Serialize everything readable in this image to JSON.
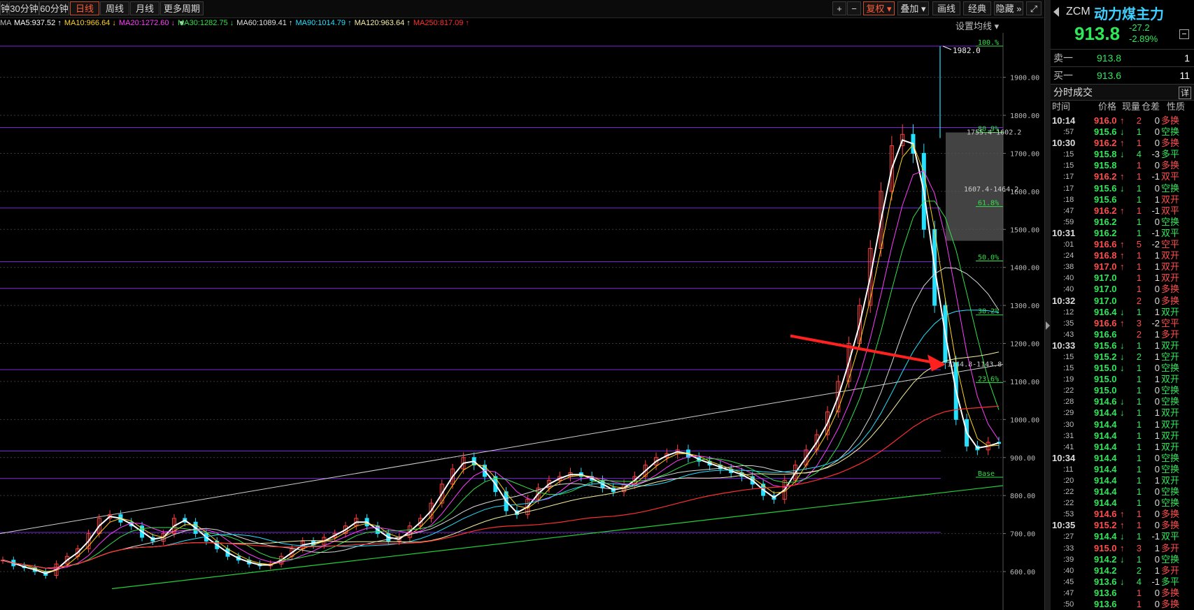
{
  "toolbar": {
    "periods": [
      {
        "label": "钟",
        "active": false
      },
      {
        "label": "30分钟",
        "active": false
      },
      {
        "label": "60分钟",
        "active": false
      },
      {
        "label": "日线",
        "active": true
      },
      {
        "label": "周线",
        "active": false
      },
      {
        "label": "月线",
        "active": false
      },
      {
        "label": "更多周期",
        "active": false
      }
    ],
    "right": {
      "plus": "+",
      "minus": "−",
      "fuquan": "复权",
      "overlay": "叠加",
      "draw": "画线",
      "classic": "经典",
      "hide": "隐藏"
    }
  },
  "ma_bar": {
    "prefix": "MA",
    "items": [
      {
        "label": "MA5:937.52",
        "arrow": "↑",
        "color": "#ffffff"
      },
      {
        "label": "MA10:966.64",
        "arrow": "↓",
        "color": "#ffd21a"
      },
      {
        "label": "MA20:1272.60",
        "arrow": "↓",
        "color": "#ff3cff"
      },
      {
        "label": "MA30:1282.75",
        "arrow": "↓",
        "color": "#33e04a"
      },
      {
        "label": "MA60:1089.41",
        "arrow": "↑",
        "color": "#e0e0e0"
      },
      {
        "label": "MA90:1014.79",
        "arrow": "↑",
        "color": "#25e0ff"
      },
      {
        "label": "MA120:963.64",
        "arrow": "↑",
        "color": "#f5f0a0"
      },
      {
        "label": "MA250:817.09",
        "arrow": "↑",
        "color": "#ff3030"
      }
    ],
    "settings": "设置均线"
  },
  "chart_data": {
    "type": "candlestick",
    "y_ticks": [
      "1900.00",
      "1800.00",
      "1700.00",
      "1600.00",
      "1500.00",
      "1400.00",
      "1300.00",
      "1200.00",
      "1100.00",
      "1000.00",
      "900.00",
      "800.00",
      "700.00",
      "600.00"
    ],
    "ylim": [
      562,
      1982
    ],
    "peak_label": "1982.0",
    "fib_labels": [
      {
        "text": "100.%",
        "value": 1982
      },
      {
        "text": "80.9%",
        "value": 1755
      },
      {
        "text": "61.8%",
        "value": 1560
      },
      {
        "text": "50.0%",
        "value": 1417
      },
      {
        "text": "38.2%",
        "value": 1275
      },
      {
        "text": "23.6%",
        "value": 1097
      },
      {
        "text": "Base",
        "value": 848
      }
    ],
    "fib_lines": [
      1982,
      1768,
      1556,
      1415,
      1345,
      1131,
      917,
      845,
      703
    ],
    "box_labels": [
      "1755.4-1602.2",
      "1607.4-1464.2",
      "1144.8-1143.8"
    ],
    "ohlc_close_path": [
      630,
      615,
      610,
      600,
      590,
      620,
      640,
      660,
      700,
      740,
      750,
      730,
      720,
      690,
      680,
      700,
      740,
      730,
      700,
      680,
      660,
      640,
      630,
      620,
      615,
      620,
      640,
      660,
      680,
      670,
      690,
      700,
      720,
      740,
      720,
      700,
      680,
      690,
      720,
      740,
      780,
      830,
      870,
      900,
      880,
      850,
      810,
      760,
      750,
      790,
      820,
      840,
      850,
      860,
      850,
      840,
      820,
      810,
      830,
      850,
      880,
      900,
      910,
      920,
      900,
      890,
      880,
      870,
      860,
      850,
      830,
      800,
      790,
      840,
      880,
      920,
      960,
      1020,
      1100,
      1200,
      1300,
      1450,
      1600,
      1720,
      1750,
      1700,
      1500,
      1300,
      1150,
      1000,
      930,
      920,
      940,
      937
    ],
    "x_days": 94
  },
  "right_panel": {
    "code": "ZCM",
    "name": "动力煤主力",
    "price": "913.8",
    "change": "-27.2",
    "change_pct": "-2.89%",
    "sell1": {
      "label": "卖一",
      "price": "913.8",
      "qty": "1"
    },
    "buy1": {
      "label": "买一",
      "price": "913.6",
      "qty": "11"
    },
    "section_title": "分时成交",
    "detail": "详",
    "headers": {
      "time": "时间",
      "price": "价格",
      "vol": "现量",
      "oi": "仓差",
      "nature": "性质"
    },
    "ticks": [
      {
        "t": "10:14",
        "big": true,
        "p": "916.0",
        "d": "↑",
        "v": "2",
        "oi": "0",
        "n": "多换",
        "pc": "red",
        "vc": "red",
        "nc": "red"
      },
      {
        "t": ":57",
        "big": false,
        "p": "915.6",
        "d": "↓",
        "v": "1",
        "oi": "0",
        "n": "空换",
        "pc": "green",
        "vc": "green",
        "nc": "green"
      },
      {
        "t": "10:30",
        "big": true,
        "p": "916.2",
        "d": "↑",
        "v": "1",
        "oi": "0",
        "n": "多换",
        "pc": "red",
        "vc": "red",
        "nc": "red"
      },
      {
        "t": ":15",
        "big": false,
        "p": "915.8",
        "d": "↓",
        "v": "4",
        "oi": "-3",
        "n": "多平",
        "pc": "green",
        "vc": "green",
        "nc": "green"
      },
      {
        "t": ":15",
        "big": false,
        "p": "915.8",
        "d": "",
        "v": "1",
        "oi": "0",
        "n": "多换",
        "pc": "green",
        "vc": "red",
        "nc": "red"
      },
      {
        "t": ":17",
        "big": false,
        "p": "916.2",
        "d": "↑",
        "v": "1",
        "oi": "-1",
        "n": "双平",
        "pc": "red",
        "vc": "red",
        "nc": "red"
      },
      {
        "t": ":17",
        "big": false,
        "p": "915.6",
        "d": "↓",
        "v": "1",
        "oi": "0",
        "n": "空换",
        "pc": "green",
        "vc": "green",
        "nc": "green"
      },
      {
        "t": ":18",
        "big": false,
        "p": "915.6",
        "d": "",
        "v": "1",
        "oi": "1",
        "n": "双开",
        "pc": "green",
        "vc": "green",
        "nc": "red"
      },
      {
        "t": ":47",
        "big": false,
        "p": "916.2",
        "d": "↑",
        "v": "1",
        "oi": "-1",
        "n": "双平",
        "pc": "red",
        "vc": "red",
        "nc": "red"
      },
      {
        "t": ":59",
        "big": false,
        "p": "916.2",
        "d": "",
        "v": "1",
        "oi": "0",
        "n": "空换",
        "pc": "green",
        "vc": "green",
        "nc": "green"
      },
      {
        "t": "10:31",
        "big": true,
        "p": "916.2",
        "d": "",
        "v": "1",
        "oi": "-1",
        "n": "双平",
        "pc": "green",
        "vc": "green",
        "nc": "green"
      },
      {
        "t": ":01",
        "big": false,
        "p": "916.6",
        "d": "↑",
        "v": "5",
        "oi": "-2",
        "n": "空平",
        "pc": "red",
        "vc": "red",
        "nc": "red"
      },
      {
        "t": ":24",
        "big": false,
        "p": "916.8",
        "d": "↑",
        "v": "1",
        "oi": "1",
        "n": "双开",
        "pc": "red",
        "vc": "red",
        "nc": "red"
      },
      {
        "t": ":38",
        "big": false,
        "p": "917.0",
        "d": "↑",
        "v": "1",
        "oi": "1",
        "n": "双开",
        "pc": "red",
        "vc": "red",
        "nc": "red"
      },
      {
        "t": ":40",
        "big": false,
        "p": "917.0",
        "d": "",
        "v": "1",
        "oi": "1",
        "n": "双开",
        "pc": "green",
        "vc": "red",
        "nc": "red"
      },
      {
        "t": ":40",
        "big": false,
        "p": "917.0",
        "d": "",
        "v": "1",
        "oi": "0",
        "n": "多换",
        "pc": "green",
        "vc": "red",
        "nc": "red"
      },
      {
        "t": "10:32",
        "big": true,
        "p": "917.0",
        "d": "",
        "v": "2",
        "oi": "0",
        "n": "多换",
        "pc": "green",
        "vc": "red",
        "nc": "red"
      },
      {
        "t": ":12",
        "big": false,
        "p": "916.4",
        "d": "↓",
        "v": "1",
        "oi": "1",
        "n": "双开",
        "pc": "green",
        "vc": "green",
        "nc": "green"
      },
      {
        "t": ":35",
        "big": false,
        "p": "916.6",
        "d": "↑",
        "v": "3",
        "oi": "-2",
        "n": "空平",
        "pc": "red",
        "vc": "red",
        "nc": "red"
      },
      {
        "t": ":43",
        "big": false,
        "p": "916.6",
        "d": "",
        "v": "2",
        "oi": "1",
        "n": "多开",
        "pc": "green",
        "vc": "red",
        "nc": "red"
      },
      {
        "t": "10:33",
        "big": true,
        "p": "915.6",
        "d": "↓",
        "v": "1",
        "oi": "1",
        "n": "双开",
        "pc": "green",
        "vc": "green",
        "nc": "green"
      },
      {
        "t": ":15",
        "big": false,
        "p": "915.2",
        "d": "↓",
        "v": "2",
        "oi": "1",
        "n": "空开",
        "pc": "green",
        "vc": "green",
        "nc": "green"
      },
      {
        "t": ":15",
        "big": false,
        "p": "915.0",
        "d": "↓",
        "v": "1",
        "oi": "0",
        "n": "空换",
        "pc": "green",
        "vc": "green",
        "nc": "green"
      },
      {
        "t": ":19",
        "big": false,
        "p": "915.0",
        "d": "",
        "v": "1",
        "oi": "1",
        "n": "双开",
        "pc": "green",
        "vc": "green",
        "nc": "green"
      },
      {
        "t": ":22",
        "big": false,
        "p": "915.0",
        "d": "",
        "v": "1",
        "oi": "0",
        "n": "空换",
        "pc": "green",
        "vc": "green",
        "nc": "green"
      },
      {
        "t": ":28",
        "big": false,
        "p": "914.6",
        "d": "↓",
        "v": "1",
        "oi": "0",
        "n": "空换",
        "pc": "green",
        "vc": "green",
        "nc": "green"
      },
      {
        "t": ":29",
        "big": false,
        "p": "914.4",
        "d": "↓",
        "v": "1",
        "oi": "1",
        "n": "双开",
        "pc": "green",
        "vc": "green",
        "nc": "green"
      },
      {
        "t": ":30",
        "big": false,
        "p": "914.4",
        "d": "",
        "v": "1",
        "oi": "1",
        "n": "双开",
        "pc": "green",
        "vc": "green",
        "nc": "green"
      },
      {
        "t": ":31",
        "big": false,
        "p": "914.4",
        "d": "",
        "v": "1",
        "oi": "1",
        "n": "双开",
        "pc": "green",
        "vc": "green",
        "nc": "green"
      },
      {
        "t": ":41",
        "big": false,
        "p": "914.4",
        "d": "",
        "v": "1",
        "oi": "1",
        "n": "双开",
        "pc": "green",
        "vc": "green",
        "nc": "green"
      },
      {
        "t": "10:34",
        "big": true,
        "p": "914.4",
        "d": "",
        "v": "1",
        "oi": "0",
        "n": "空换",
        "pc": "green",
        "vc": "green",
        "nc": "green"
      },
      {
        "t": ":11",
        "big": false,
        "p": "914.4",
        "d": "",
        "v": "1",
        "oi": "0",
        "n": "空换",
        "pc": "green",
        "vc": "green",
        "nc": "green"
      },
      {
        "t": ":20",
        "big": false,
        "p": "914.4",
        "d": "",
        "v": "1",
        "oi": "1",
        "n": "双开",
        "pc": "green",
        "vc": "green",
        "nc": "green"
      },
      {
        "t": ":22",
        "big": false,
        "p": "914.4",
        "d": "",
        "v": "1",
        "oi": "0",
        "n": "空换",
        "pc": "green",
        "vc": "green",
        "nc": "green"
      },
      {
        "t": ":22",
        "big": false,
        "p": "914.4",
        "d": "",
        "v": "1",
        "oi": "0",
        "n": "空换",
        "pc": "green",
        "vc": "green",
        "nc": "green"
      },
      {
        "t": ":53",
        "big": false,
        "p": "914.6",
        "d": "↑",
        "v": "1",
        "oi": "0",
        "n": "多换",
        "pc": "red",
        "vc": "red",
        "nc": "red"
      },
      {
        "t": "10:35",
        "big": true,
        "p": "915.2",
        "d": "↑",
        "v": "1",
        "oi": "0",
        "n": "多换",
        "pc": "red",
        "vc": "red",
        "nc": "red"
      },
      {
        "t": ":27",
        "big": false,
        "p": "914.4",
        "d": "↓",
        "v": "1",
        "oi": "-1",
        "n": "双平",
        "pc": "green",
        "vc": "green",
        "nc": "green"
      },
      {
        "t": ":33",
        "big": false,
        "p": "915.0",
        "d": "↑",
        "v": "3",
        "oi": "1",
        "n": "多开",
        "pc": "red",
        "vc": "red",
        "nc": "red"
      },
      {
        "t": ":39",
        "big": false,
        "p": "914.2",
        "d": "↓",
        "v": "1",
        "oi": "0",
        "n": "空换",
        "pc": "green",
        "vc": "green",
        "nc": "green"
      },
      {
        "t": ":40",
        "big": false,
        "p": "914.2",
        "d": "",
        "v": "2",
        "oi": "1",
        "n": "多开",
        "pc": "green",
        "vc": "green",
        "nc": "red"
      },
      {
        "t": ":45",
        "big": false,
        "p": "913.6",
        "d": "↓",
        "v": "4",
        "oi": "-1",
        "n": "多平",
        "pc": "green",
        "vc": "green",
        "nc": "green"
      },
      {
        "t": ":47",
        "big": false,
        "p": "913.6",
        "d": "",
        "v": "1",
        "oi": "0",
        "n": "多换",
        "pc": "green",
        "vc": "red",
        "nc": "red"
      },
      {
        "t": ":50",
        "big": false,
        "p": "913.6",
        "d": "",
        "v": "1",
        "oi": "0",
        "n": "多换",
        "pc": "green",
        "vc": "red",
        "nc": "red"
      }
    ]
  }
}
